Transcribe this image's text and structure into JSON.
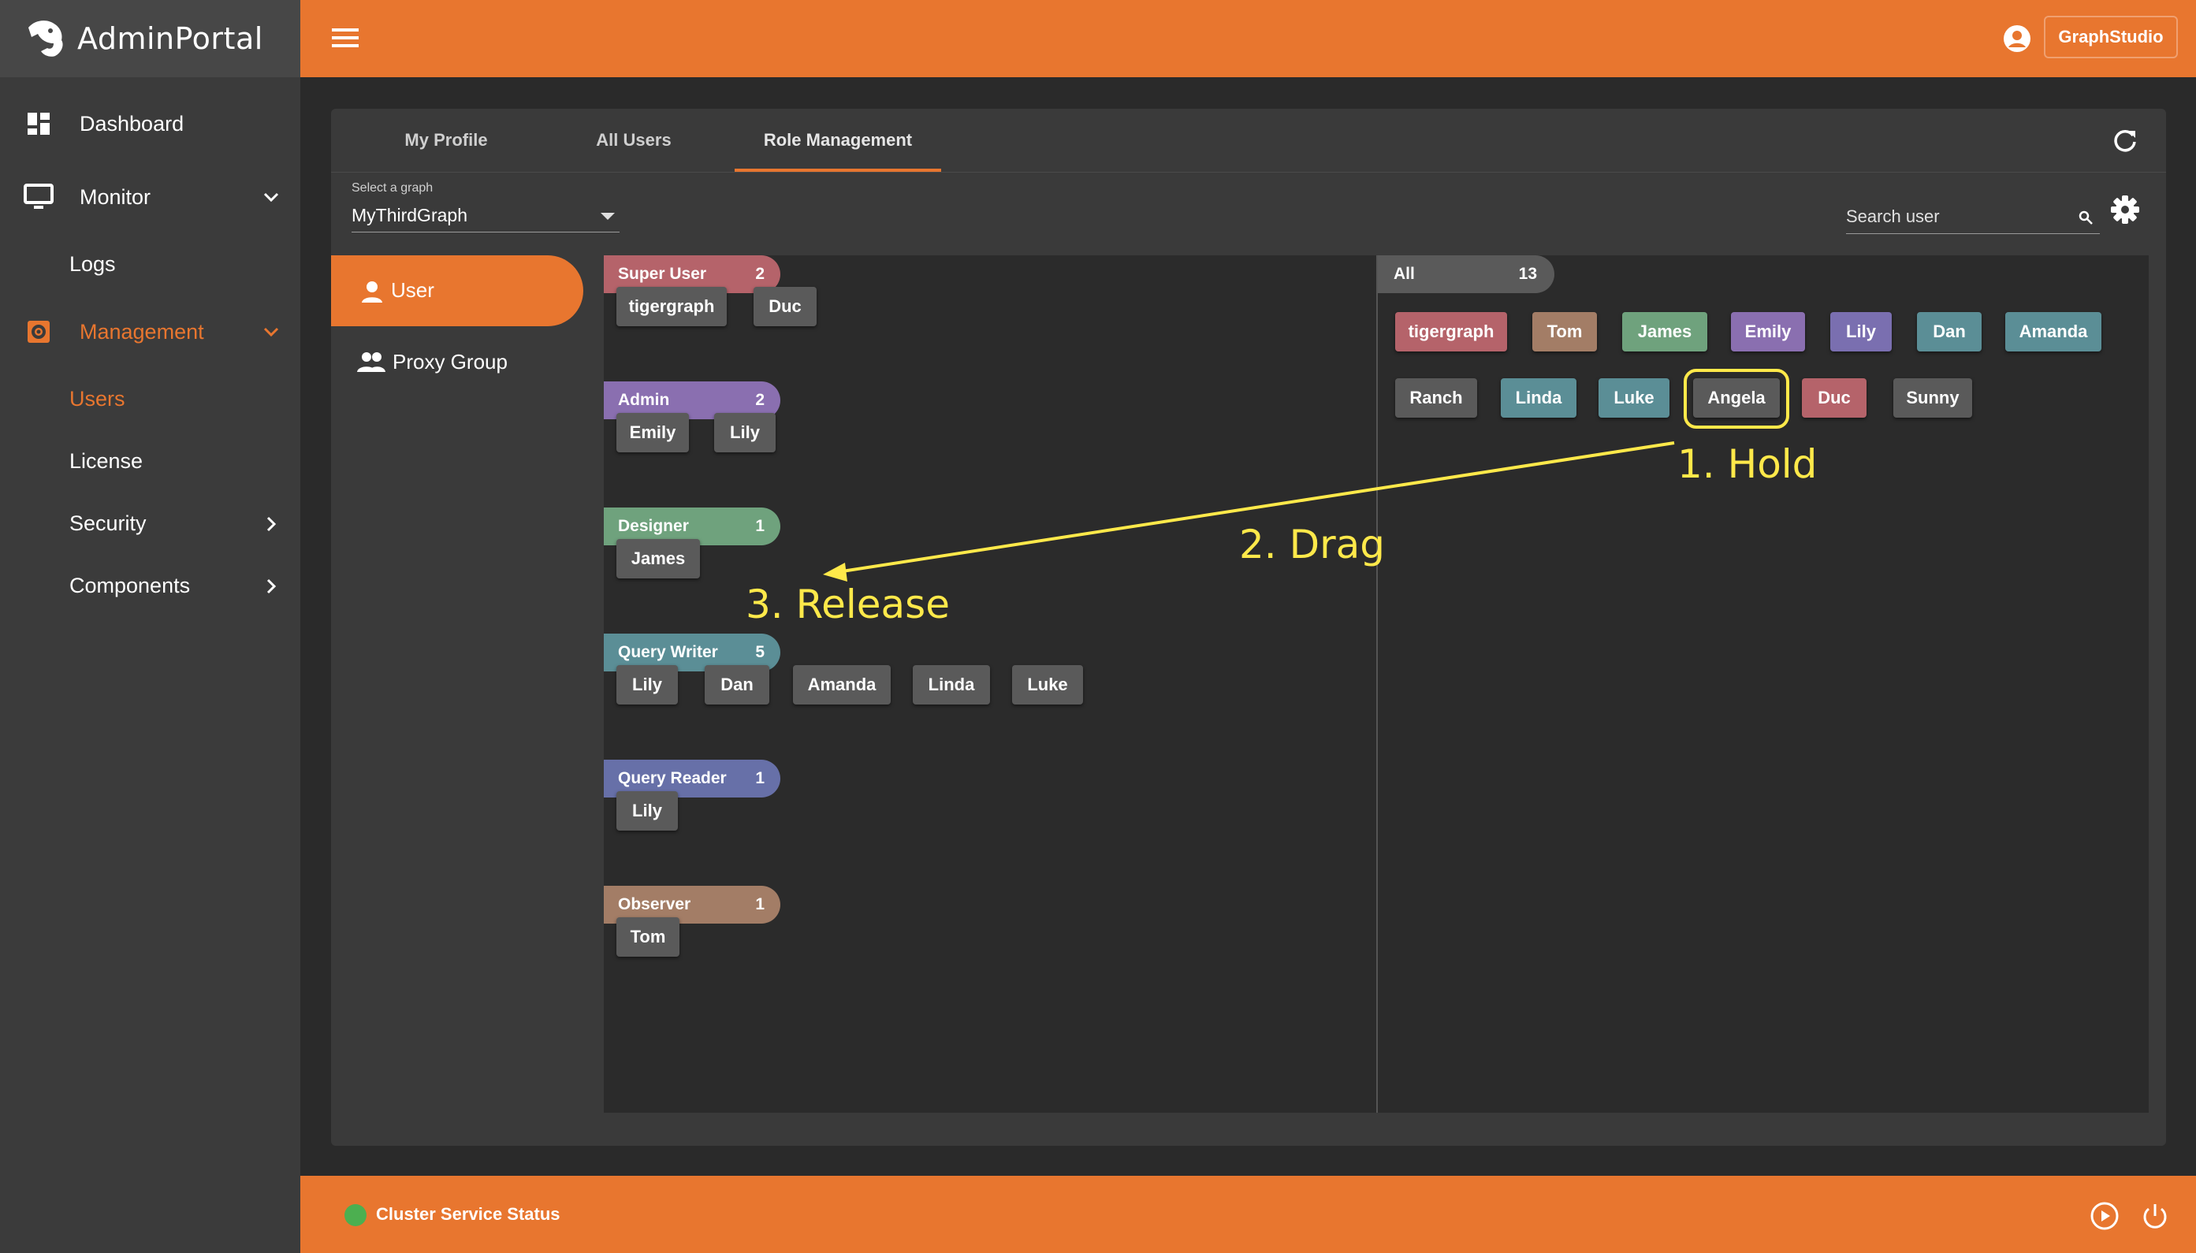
{
  "app": {
    "brand": "AdminPortal"
  },
  "sidebar": {
    "items": [
      {
        "label": "Dashboard"
      },
      {
        "label": "Monitor"
      },
      {
        "label": "Logs"
      },
      {
        "label": "Management"
      },
      {
        "label": "Users"
      },
      {
        "label": "License"
      },
      {
        "label": "Security"
      },
      {
        "label": "Components"
      }
    ]
  },
  "header": {
    "graphstudio_label": "GraphStudio"
  },
  "tabs": [
    {
      "label": "My Profile"
    },
    {
      "label": "All Users"
    },
    {
      "label": "Role Management"
    }
  ],
  "graph_select": {
    "label": "Select a graph",
    "value": "MyThirdGraph"
  },
  "search": {
    "placeholder": "Search user"
  },
  "left_nav": {
    "user_label": "User",
    "proxy_label": "Proxy Group"
  },
  "roles": [
    {
      "name": "Super User",
      "count": "2",
      "color": "#b5636a",
      "users": [
        "tigergraph",
        "Duc"
      ]
    },
    {
      "name": "Admin",
      "count": "2",
      "color": "#8a6fb0",
      "users": [
        "Emily",
        "Lily"
      ]
    },
    {
      "name": "Designer",
      "count": "1",
      "color": "#6fa27d",
      "users": [
        "James"
      ]
    },
    {
      "name": "Query Writer",
      "count": "5",
      "color": "#5b8e96",
      "users": [
        "Lily",
        "Dan",
        "Amanda",
        "Linda",
        "Luke"
      ]
    },
    {
      "name": "Query Reader",
      "count": "1",
      "color": "#6770a8",
      "users": [
        "Lily"
      ]
    },
    {
      "name": "Observer",
      "count": "1",
      "color": "#a37d66",
      "users": [
        "Tom"
      ]
    }
  ],
  "all_users": {
    "label": "All",
    "count": "13",
    "rows": [
      [
        {
          "name": "tigergraph",
          "color": "#b5636a"
        },
        {
          "name": "Tom",
          "color": "#a37d66"
        },
        {
          "name": "James",
          "color": "#6fa27d"
        },
        {
          "name": "Emily",
          "color": "#8a6fb0"
        },
        {
          "name": "Lily",
          "color": "#7a6fb0"
        },
        {
          "name": "Dan",
          "color": "#5b8e96"
        },
        {
          "name": "Amanda",
          "color": "#5b8e96"
        }
      ],
      [
        {
          "name": "Ranch",
          "color": "#5a5a5a"
        },
        {
          "name": "Linda",
          "color": "#5b8e96"
        },
        {
          "name": "Luke",
          "color": "#5b8e96"
        },
        {
          "name": "Angela",
          "color": "#5a5a5a"
        },
        {
          "name": "Duc",
          "color": "#b5636a"
        },
        {
          "name": "Sunny",
          "color": "#5a5a5a"
        }
      ]
    ]
  },
  "annotations": {
    "hold": "1. Hold",
    "drag": "2. Drag",
    "release": "3. Release"
  },
  "footer": {
    "status": "Cluster Service Status"
  },
  "colors": {
    "accent": "#e8762f",
    "annotation": "#ffe94a",
    "status_ok": "#4caf50"
  }
}
